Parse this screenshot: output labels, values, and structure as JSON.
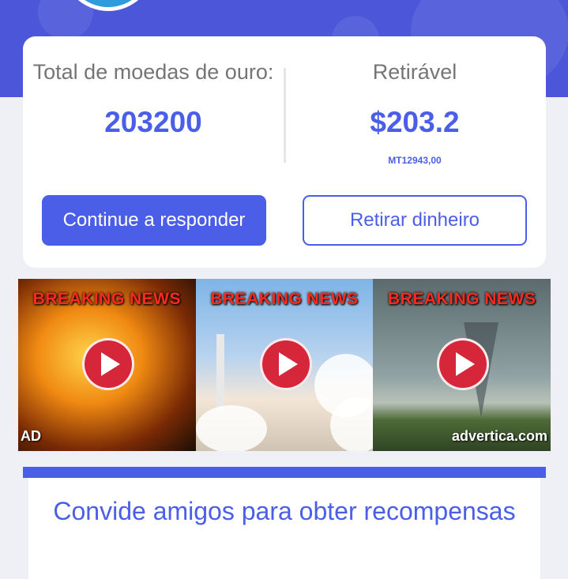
{
  "wallet": {
    "total_label": "Total de moedas de ouro:",
    "total_value": "203200",
    "withdrawable_label": "Retirável",
    "withdrawable_value": "$203.2",
    "local_value": "MT12943,00",
    "continue_button": "Continue a responder",
    "withdraw_button": "Retirar dinheiro"
  },
  "ad": {
    "headline": "BREAKING NEWS",
    "tag": "AD",
    "brand": "advertica.com",
    "tiles": [
      "fire",
      "rocket",
      "tornado"
    ]
  },
  "invite": {
    "title": "Convide amigos para obter recompensas"
  },
  "colors": {
    "accent": "#4b5ee8",
    "header": "#4b56d8",
    "ad_headline": "#ff2a1f",
    "play_button": "#d6263a"
  }
}
